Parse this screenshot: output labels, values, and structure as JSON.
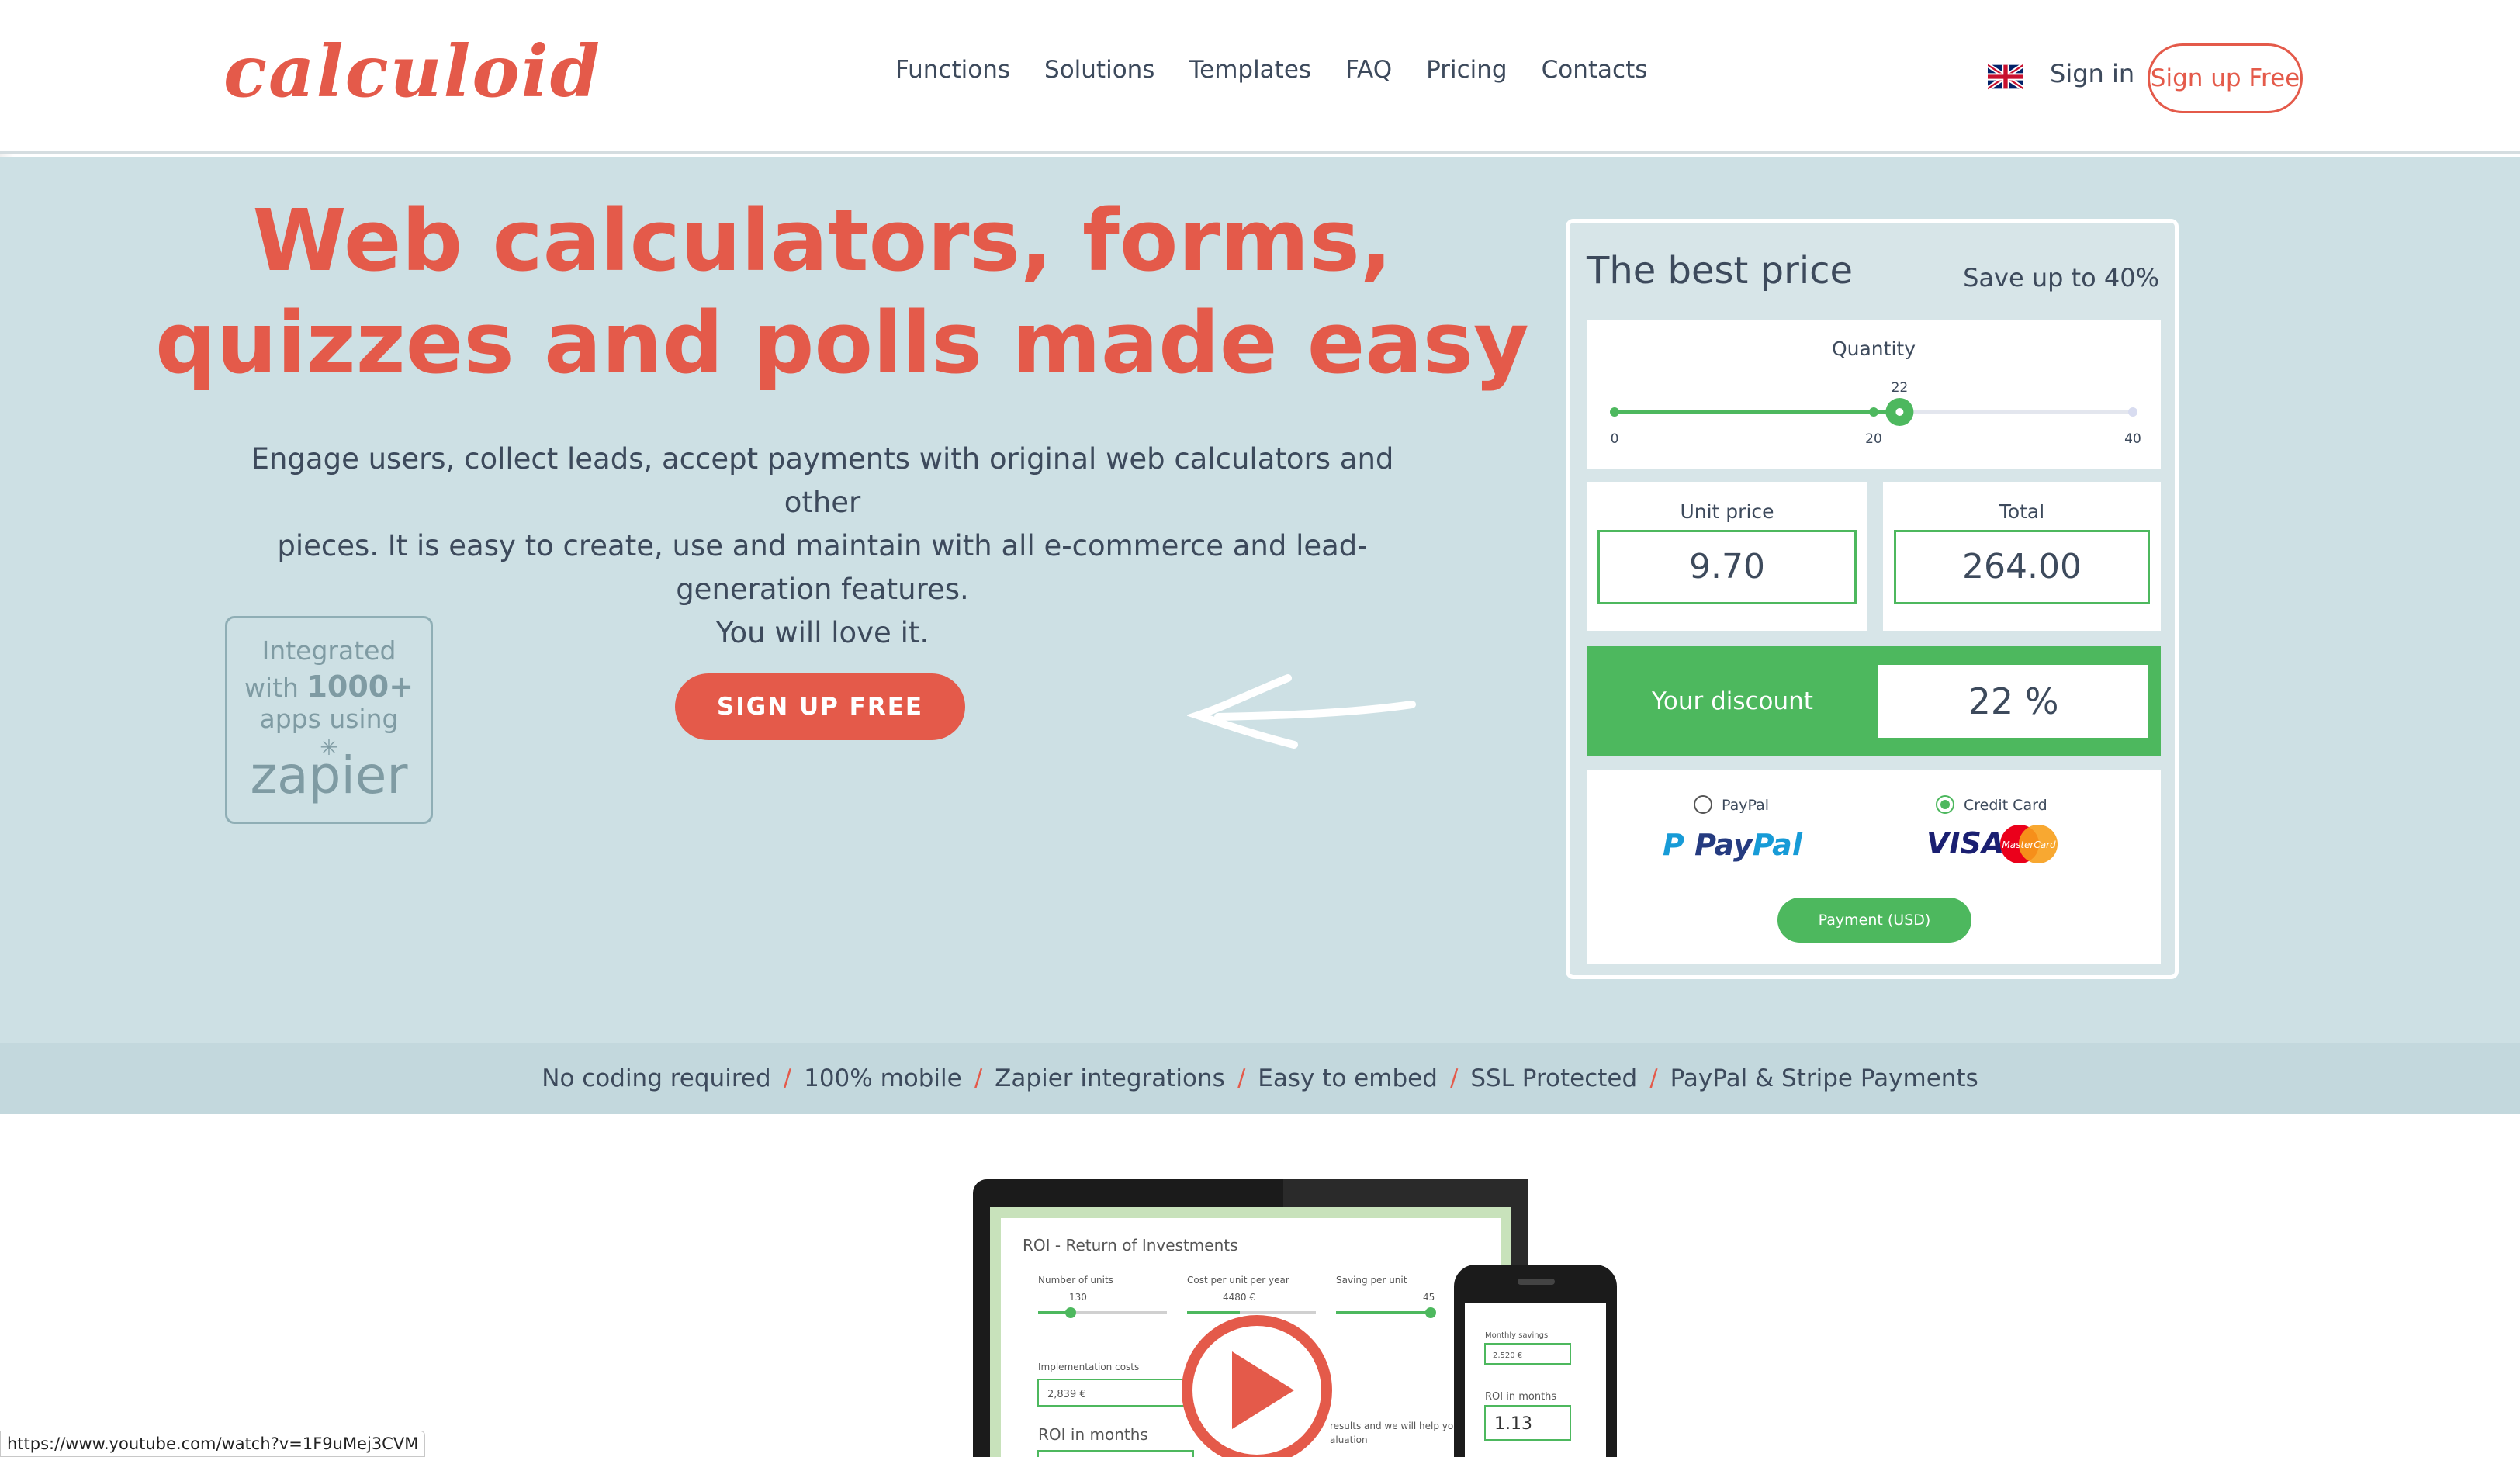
{
  "header": {
    "logo": "calculoid",
    "nav": [
      "Functions",
      "Solutions",
      "Templates",
      "FAQ",
      "Pricing",
      "Contacts"
    ],
    "signin": "Sign in",
    "signup": "Sign up Free",
    "language_icon": "uk-flag-icon"
  },
  "hero": {
    "title_line1": "Web calculators, forms,",
    "title_line2": "quizzes and polls made easy",
    "subtitle_line1": "Engage users, collect leads, accept payments with original web calculators and other",
    "subtitle_line2": "pieces. It is easy to create, use and maintain with all e-commerce and lead-",
    "subtitle_line3": "generation features.",
    "subtitle_line4": "You will love it.",
    "cta": "SIGN UP FREE",
    "zapier": {
      "line1": "Integrated",
      "line2_prefix": "with ",
      "line2_bold": "1000+",
      "line3": "apps using",
      "logo": "zapier"
    }
  },
  "calculator": {
    "title": "The best price",
    "save": "Save up to 40%",
    "quantity_label": "Quantity",
    "slider": {
      "min": 0,
      "max": 40,
      "mid_tick": 20,
      "value": 22
    },
    "slider_labels": {
      "min": "0",
      "mid": "20",
      "max": "40",
      "value": "22"
    },
    "unit_price_label": "Unit price",
    "unit_price": "9.70",
    "total_label": "Total",
    "total": "264.00",
    "discount_label": "Your discount",
    "discount": "22 %",
    "payment_options": [
      {
        "label": "PayPal",
        "checked": false
      },
      {
        "label": "Credit Card",
        "checked": true
      }
    ],
    "paypal_logo": {
      "p1": "Pay",
      "p2": "Pal"
    },
    "visa_logo": "VISA",
    "mastercard_logo": "MasterCard",
    "payment_button": "Payment (USD)"
  },
  "features": [
    "No coding required",
    "100% mobile",
    "Zapier integrations",
    "Easy to embed",
    "SSL Protected",
    "PayPal & Stripe Payments"
  ],
  "preview": {
    "title": "ROI - Return of Investments",
    "labels": [
      "Number of units",
      "Cost per unit per year",
      "Saving per unit"
    ],
    "values": [
      "130",
      "4480 €",
      "45"
    ],
    "impl_label": "Implementation costs",
    "impl_value": "2,839 €",
    "roi_label": "ROI in months",
    "note": "results and we will help yo",
    "note2": "aluation",
    "phone_label1": "Monthly savings",
    "phone_value1": "2,520 €",
    "phone_label2": "ROI in months",
    "phone_value2": "1.13"
  },
  "status_url": "https://www.youtube.com/watch?v=1F9uMej3CVM",
  "colors": {
    "accent": "#e45a4a",
    "green": "#4db85e",
    "hero_bg": "#cde0e4",
    "strip_bg": "#c3d8dd"
  }
}
